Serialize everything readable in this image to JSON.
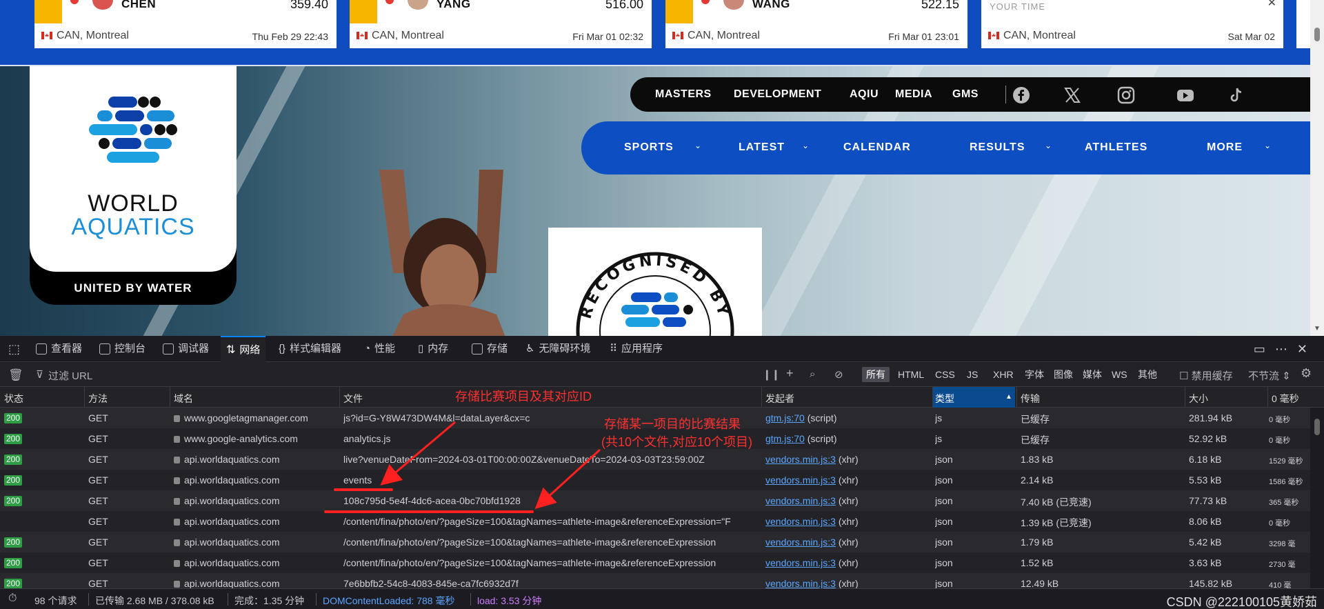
{
  "ticker": {
    "cards": [
      {
        "name": "CHEN",
        "score": "359.40",
        "location": "CAN, Montreal",
        "time": "Thu Feb 29 22:43"
      },
      {
        "name": "YANG",
        "score": "516.00",
        "location": "CAN, Montreal",
        "time": "Fri Mar 01 02:32"
      },
      {
        "name": "WANG",
        "score": "522.15",
        "location": "CAN, Montreal",
        "time": "Fri Mar 01 23:01"
      },
      {
        "name": "YOUR TIME",
        "score": "",
        "location": "CAN, Montreal",
        "time": "Sat Mar 02"
      }
    ]
  },
  "logo": {
    "line1": "WORLD",
    "line2": "AQUATICS",
    "tagline": "UNITED BY WATER"
  },
  "recognised": {
    "text": "RECOGNISED BY"
  },
  "topnav": {
    "items": [
      "MASTERS",
      "DEVELOPMENT",
      "AQIU",
      "MEDIA",
      "GMS"
    ],
    "social": [
      "facebook-icon",
      "x-icon",
      "instagram-icon",
      "youtube-icon",
      "tiktok-icon"
    ]
  },
  "mainnav": {
    "items": [
      {
        "label": "SPORTS",
        "dropdown": true
      },
      {
        "label": "LATEST",
        "dropdown": true
      },
      {
        "label": "CALENDAR",
        "dropdown": false
      },
      {
        "label": "RESULTS",
        "dropdown": true
      },
      {
        "label": "ATHLETES",
        "dropdown": false
      },
      {
        "label": "MORE",
        "dropdown": true
      }
    ]
  },
  "devtools": {
    "tabs": [
      "查看器",
      "控制台",
      "调试器",
      "网络",
      "样式编辑器",
      "性能",
      "内存",
      "存储",
      "无障碍环境",
      "应用程序"
    ],
    "active_tab": "网络",
    "filter_placeholder": "过滤 URL",
    "types": [
      "所有",
      "HTML",
      "CSS",
      "JS",
      "XHR",
      "字体",
      "图像",
      "媒体",
      "WS",
      "其他"
    ],
    "disable_cache": "禁用缓存",
    "throttle": "不节流 ⇕",
    "columns": [
      "状态",
      "方法",
      "域名",
      "文件",
      "发起者",
      "类型",
      "传输",
      "大小",
      "0 毫秒"
    ],
    "rows": [
      {
        "status": "200",
        "method": "GET",
        "domain": "www.googletagmanager.com",
        "file": "js?id=G-Y8W473DW4M&l=dataLayer&cx=c",
        "initiator": "gtm.js:70",
        "initiator_type": "(script)",
        "type": "js",
        "transfer": "已缓存",
        "size": "281.94 kB",
        "timing": "0 毫秒"
      },
      {
        "status": "200",
        "method": "GET",
        "domain": "www.google-analytics.com",
        "file": "analytics.js",
        "initiator": "gtm.js:70",
        "initiator_type": "(script)",
        "type": "js",
        "transfer": "已缓存",
        "size": "52.92 kB",
        "timing": "0 毫秒"
      },
      {
        "status": "200",
        "method": "GET",
        "domain": "api.worldaquatics.com",
        "file": "live?venueDateFrom=2024-03-01T00:00:00Z&venueDateTo=2024-03-03T23:59:00Z",
        "initiator": "vendors.min.js:3",
        "initiator_type": "(xhr)",
        "type": "json",
        "transfer": "1.83 kB",
        "size": "6.18 kB",
        "timing": "1529 毫秒"
      },
      {
        "status": "200",
        "method": "GET",
        "domain": "api.worldaquatics.com",
        "file": "events",
        "initiator": "vendors.min.js:3",
        "initiator_type": "(xhr)",
        "type": "json",
        "transfer": "2.14 kB",
        "size": "5.53 kB",
        "timing": "1586 毫秒"
      },
      {
        "status": "200",
        "method": "GET",
        "domain": "api.worldaquatics.com",
        "file": "108c795d-5e4f-4dc6-acea-0bc70bfd1928",
        "initiator": "vendors.min.js:3",
        "initiator_type": "(xhr)",
        "type": "json",
        "transfer": "7.40 kB (已竞速)",
        "size": "77.73 kB",
        "timing": "365 毫秒"
      },
      {
        "status": "",
        "method": "GET",
        "domain": "api.worldaquatics.com",
        "file": "/content/fina/photo/en/?pageSize=100&tagNames=athlete-image&referenceExpression=\"F",
        "initiator": "vendors.min.js:3",
        "initiator_type": "(xhr)",
        "type": "json",
        "transfer": "1.39 kB (已竞速)",
        "size": "8.06 kB",
        "timing": "0 毫秒"
      },
      {
        "status": "200",
        "method": "GET",
        "domain": "api.worldaquatics.com",
        "file": "/content/fina/photo/en/?pageSize=100&tagNames=athlete-image&referenceExpression",
        "initiator": "vendors.min.js:3",
        "initiator_type": "(xhr)",
        "type": "json",
        "transfer": "1.79 kB",
        "size": "5.42 kB",
        "timing": "3298 毫"
      },
      {
        "status": "200",
        "method": "GET",
        "domain": "api.worldaquatics.com",
        "file": "/content/fina/photo/en/?pageSize=100&tagNames=athlete-image&referenceExpression",
        "initiator": "vendors.min.js:3",
        "initiator_type": "(xhr)",
        "type": "json",
        "transfer": "1.52 kB",
        "size": "3.63 kB",
        "timing": "2730 毫"
      },
      {
        "status": "200",
        "method": "GET",
        "domain": "api.worldaquatics.com",
        "file": "7e6bbfb2-54c8-4083-845e-ca7fc6932d7f",
        "initiator": "vendors.min.js:3",
        "initiator_type": "(xhr)",
        "type": "json",
        "transfer": "12.49 kB",
        "size": "145.82 kB",
        "timing": "410 毫"
      }
    ],
    "status_bar": {
      "requests": "98 个请求",
      "transferred": "已传输 2.68 MB / 378.08 kB",
      "finish": "完成：1.35 分钟",
      "dcl": "DOMContentLoaded: 788 毫秒",
      "load": "load: 3.53 分钟"
    }
  },
  "annotations": {
    "a1": "存储比赛项目及其对应ID",
    "a2_line1": "存储某一项目的比赛结果",
    "a2_line2": "(共10个文件,对应10个项目)"
  },
  "watermark": "CSDN @222100105黄娇茹"
}
